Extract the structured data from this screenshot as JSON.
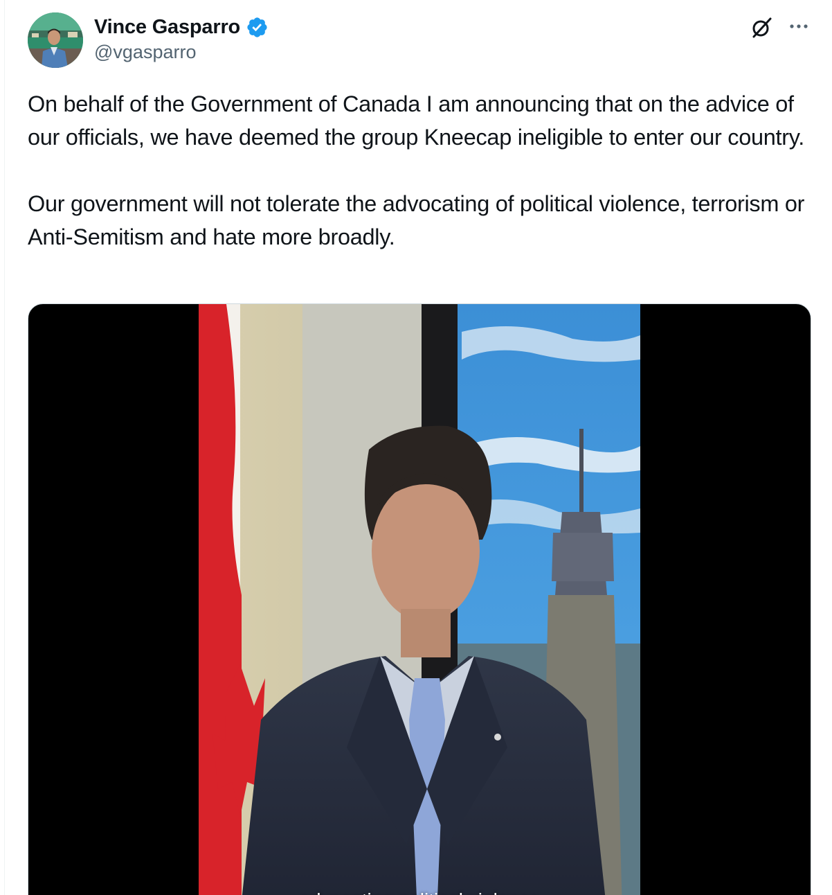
{
  "author": {
    "display_name": "Vince Gasparro",
    "handle": "@vgasparro",
    "verified": true,
    "verified_color": "#1d9bf0",
    "avatar_icon": "user-avatar-photo"
  },
  "header_actions": {
    "grok_icon": "grok-slash-icon",
    "more_icon": "more-dots-icon"
  },
  "tweet": {
    "paragraphs": [
      "On behalf of the Government of Canada I am announcing that on the advice of our officials, we have deemed the group Kneecap ineligible to enter our country.",
      "Our government will not tolerate the advocating of political violence, terrorism or Anti-Semitism and hate more broadly."
    ]
  },
  "media": {
    "type": "video",
    "caption": "advocating political violence"
  },
  "colors": {
    "text": "#0f1419",
    "secondary": "#536471",
    "border": "#cfd9de"
  }
}
